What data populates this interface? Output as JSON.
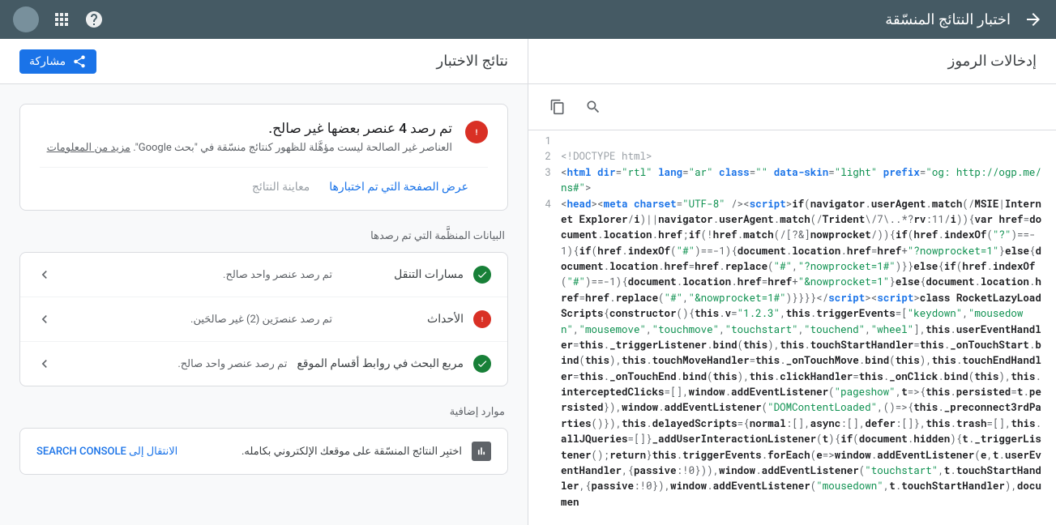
{
  "topbar": {
    "title": "اختبار النتائج المنسّقة"
  },
  "right_pane": {
    "title": "إدخالات الرموز"
  },
  "left_pane": {
    "title": "نتائج الاختبار",
    "share_label": "مشاركة"
  },
  "summary": {
    "title": "تم رصد 4 عنصر بعضها غير صالح.",
    "subtitle_prefix": "العناصر غير الصالحة ليست مؤهَّلة للظهور كنتائج منسّقة في \"بحث Google\". ",
    "more_info": "مزيد من المعلومات",
    "action_view_page": "عرض الصفحة التي تم اختبارها",
    "action_preview": "معاينة النتائج"
  },
  "detected_label": "البيانات المنظَّمة التي تم رصدها",
  "items": [
    {
      "label": "مسارات التنقل",
      "detail": "تم رصد عنصر واحد صالح.",
      "status": "success"
    },
    {
      "label": "الأحداث",
      "detail": "تم رصد عنصرَين (2) غير صالحَين.",
      "status": "error"
    },
    {
      "label": "مربع البحث في روابط أقسام الموقع",
      "detail": "تم رصد عنصر واحد صالح.",
      "status": "success"
    }
  ],
  "resources_label": "موارد إضافية",
  "resource": {
    "text": "اختبِر النتائج المنسّقة على موقعك الإلكتروني بكامله.",
    "link": "الانتقال إلى SEARCH CONSOLE"
  },
  "code": {
    "line1": "",
    "line2": "<!DOCTYPE html>",
    "line3_raw": "<html dir=\"rtl\" lang=\"ar\" class=\"\" data-skin=\"light\" prefix=\"og: http://ogp.me/ns#\">",
    "line4_raw": "<head><meta charset=\"UTF-8\" /><script>if(navigator.userAgent.match(/MSIE|Internet Explorer/i)||navigator.userAgent.match(/Trident\\/7\\..*?rv:11/i)){var href=document.location.href;if(!href.match(/[?&]nowprocket/)){if(href.indexOf(\"?\")==-1){if(href.indexOf(\"#\")==-1){document.location.href=href+\"?nowprocket=1\"}else{document.location.href=href.replace(\"#\",\"?nowprocket=1#\")}}else{if(href.indexOf(\"#\")==-1){document.location.href=href+\"&nowprocket=1\"}else{document.location.href=href.replace(\"#\",\"&nowprocket=1#\")}}}}</script><script>class RocketLazyLoadScripts{constructor(){this.v=\"1.2.3\",this.triggerEvents=[\"keydown\",\"mousedown\",\"mousemove\",\"touchmove\",\"touchstart\",\"touchend\",\"wheel\"],this.userEventHandler=this._triggerListener.bind(this),this.touchStartHandler=this._onTouchStart.bind(this),this.touchMoveHandler=this._onTouchMove.bind(this),this.touchEndHandler=this._onTouchEnd.bind(this),this.clickHandler=this._onClick.bind(this),this.interceptedClicks=[],window.addEventListener(\"pageshow\",t=>{this.persisted=t.persisted}),window.addEventListener(\"DOMContentLoaded\",()=>{this._preconnect3rdParties()}),this.delayedScripts={normal:[],async:[],defer:[]},this.trash=[],this.allJQueries=[]}_addUserInteractionListener(t){if(document.hidden){t._triggerListener();return}this.triggerEvents.forEach(e=>window.addEventListener(e,t.userEventHandler,{passive:!0})),window.addEventListener(\"touchstart\",t.touchStartHandler,{passive:!0}),window.addEventListener(\"mousedown\",t.touchStartHandler),documen"
  }
}
